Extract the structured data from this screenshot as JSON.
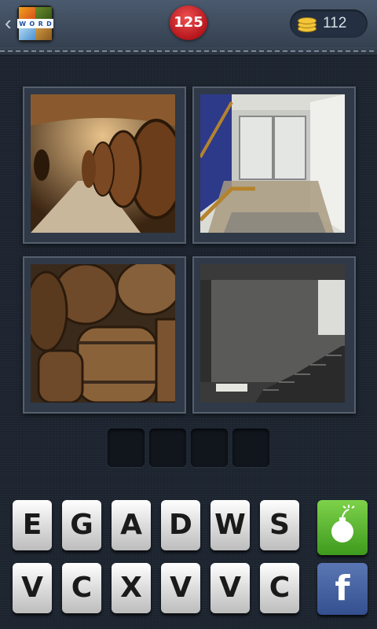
{
  "header": {
    "back_icon": "chevron-left-icon",
    "logo_letters": [
      "W",
      "O",
      "R",
      "D"
    ],
    "level_number": "125",
    "coins_icon": "coin-stack-icon",
    "coins_count": "112"
  },
  "puzzle": {
    "images": [
      {
        "subject": "wine cellar barrels"
      },
      {
        "subject": "flooded basement"
      },
      {
        "subject": "stacked barrels"
      },
      {
        "subject": "concrete basement staircase"
      }
    ],
    "answer_slots": [
      "",
      "",
      "",
      ""
    ]
  },
  "letters": {
    "row1": [
      "E",
      "G",
      "A",
      "D",
      "W",
      "S"
    ],
    "row2": [
      "V",
      "C",
      "X",
      "V",
      "V",
      "C"
    ]
  },
  "helpers": {
    "bomb_icon": "bomb-icon",
    "facebook_label": "f",
    "colors": {
      "bomb": "#5cb832",
      "facebook": "#3b5998",
      "level_badge": "#d5262c"
    }
  }
}
